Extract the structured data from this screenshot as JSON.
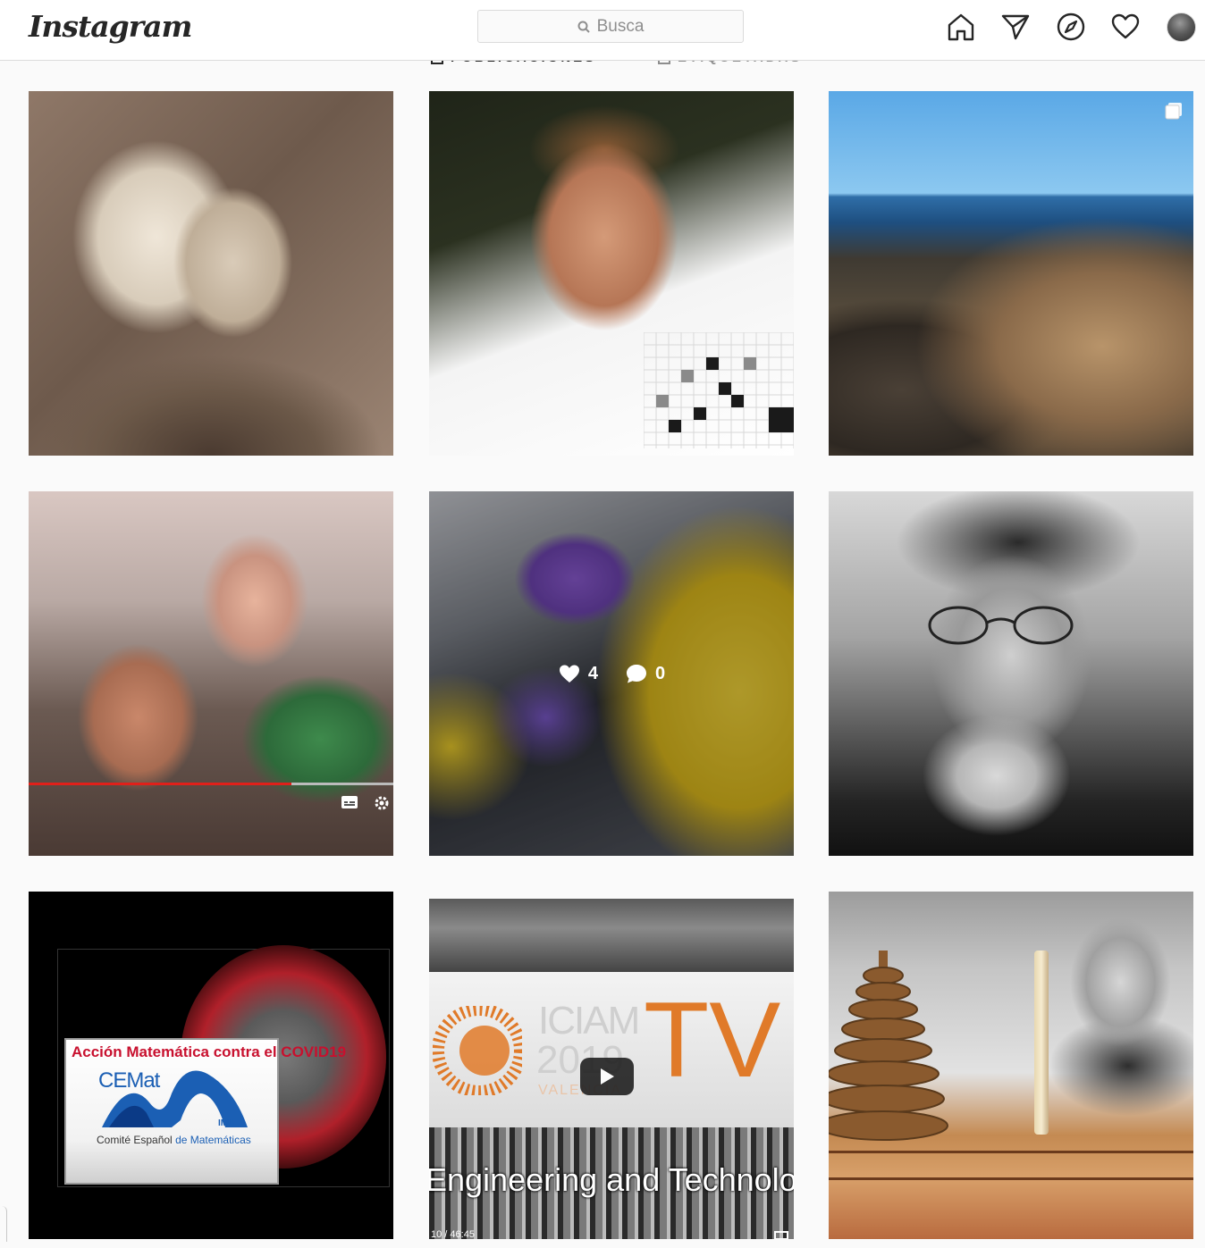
{
  "app": {
    "logo_text": "Instagram"
  },
  "header": {
    "search_placeholder": "Busca",
    "nav_icons": [
      "home-icon",
      "direct-message-icon",
      "explore-compass-icon",
      "activity-heart-icon",
      "profile-avatar"
    ]
  },
  "tabs": [
    {
      "label": "PUBLICACIONES",
      "icon": "grid-icon"
    },
    {
      "label": "ETIQUETADAS",
      "icon": "tagged-icon"
    }
  ],
  "posts": [
    {
      "id": "post-1",
      "description_icon": "portrait-engraving"
    },
    {
      "id": "post-2",
      "description_icon": "man-with-grid-pattern"
    },
    {
      "id": "post-3",
      "description_icon": "coastal-basalt-columns",
      "multi_image": true
    },
    {
      "id": "post-4",
      "description_icon": "video-still-people",
      "overlay_captions": [
        "subtitles-icon",
        "settings-gear-icon"
      ]
    },
    {
      "id": "post-5",
      "description_icon": "medical-test-swab",
      "hovered": true,
      "likes": "4",
      "comments": "0"
    },
    {
      "id": "post-6",
      "description_icon": "bearded-man-portrait"
    },
    {
      "id": "post-7",
      "description_icon": "covid-banner",
      "banner_title": "Acción Matemática contra el COVID19",
      "logo_text": "CEMat",
      "logo_sub": "IMU",
      "committee_text_1": "Comité Español",
      "committee_text_2": "de Matemáticas"
    },
    {
      "id": "post-8",
      "description_icon": "iciam-tv-video",
      "brand_1": "ICIAM",
      "brand_2": "2019",
      "brand_3": "VALENCIA",
      "brand_tv": "TV",
      "banner_text": "Engineering and Technolog",
      "timecode": "10 / 46:45"
    },
    {
      "id": "post-9",
      "description_icon": "tower-of-hanoi-portrait"
    }
  ],
  "colors": {
    "accent_orange": "#e07a29",
    "banner_red": "#c8102e",
    "cemat_blue": "#1b5fb4",
    "background": "#fafafa"
  }
}
